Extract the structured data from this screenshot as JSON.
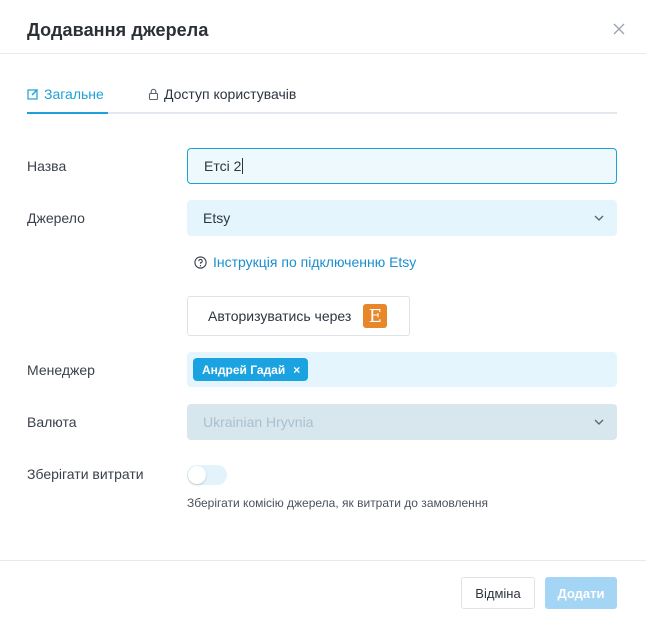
{
  "dialog": {
    "title": "Додавання джерела",
    "close_icon": "close-icon"
  },
  "tabs": [
    {
      "label": "Загальне",
      "icon": "edit-icon",
      "active": true
    },
    {
      "label": "Доступ користувачів",
      "icon": "lock-icon",
      "active": false
    }
  ],
  "form": {
    "name": {
      "label": "Назва",
      "value": "Етсі 2"
    },
    "source": {
      "label": "Джерело",
      "value": "Etsy"
    },
    "help_link": {
      "icon": "help-circle-icon",
      "text": "Інструкція по підключенню Etsy"
    },
    "auth_button": {
      "label": "Авторизуватись через",
      "logo": "E"
    },
    "manager": {
      "label": "Менеджер",
      "chip": "Андрей Гадай",
      "remove": "×"
    },
    "currency": {
      "label": "Валюта",
      "value": "Ukrainian Hryvnia",
      "disabled": true
    },
    "save_expenses": {
      "label": "Зберігати витрати",
      "enabled": false,
      "hint": "Зберігати комісію джерела, як витрати до замовлення"
    }
  },
  "footer": {
    "cancel_label": "Відміна",
    "save_label": "Додати"
  },
  "colors": {
    "accent": "#1da1d8",
    "chip": "#1aa3e0",
    "etsy": "#e8862a",
    "save_disabled": "#a4d5f5"
  }
}
